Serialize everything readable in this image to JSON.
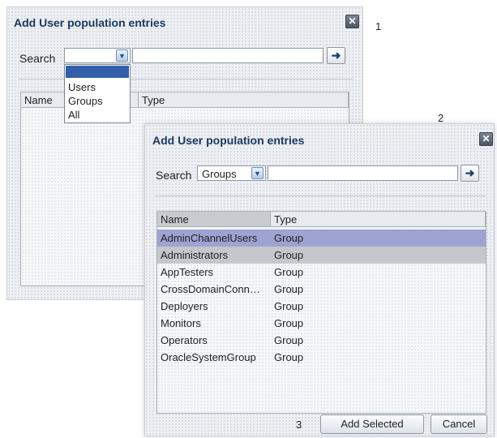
{
  "step_numbers": [
    "1",
    "2",
    "3"
  ],
  "dialog1": {
    "title": "Add User population entries",
    "close_icon": "close-icon",
    "search_label": "Search",
    "search_select_value": "",
    "search_input_value": "",
    "dropdown_options": [
      "",
      "Users",
      "Groups",
      "All"
    ],
    "columns": [
      "Name",
      "Type"
    ]
  },
  "dialog2": {
    "title": "Add User population entries",
    "close_icon": "close-icon",
    "search_label": "Search",
    "search_select_value": "Groups",
    "search_input_value": "",
    "columns": [
      "Name",
      "Type"
    ],
    "rows": [
      {
        "name": "AdminChannelUsers",
        "type": "Group"
      },
      {
        "name": "Administrators",
        "type": "Group"
      },
      {
        "name": "AppTesters",
        "type": "Group"
      },
      {
        "name": "CrossDomainConn…",
        "type": "Group"
      },
      {
        "name": "Deployers",
        "type": "Group"
      },
      {
        "name": "Monitors",
        "type": "Group"
      },
      {
        "name": "Operators",
        "type": "Group"
      },
      {
        "name": "OracleSystemGroup",
        "type": "Group"
      }
    ],
    "add_selected_label": "Add Selected",
    "cancel_label": "Cancel"
  },
  "colors": {
    "row_selected": "#9ea3d2",
    "row_hover": "#c4c7cc",
    "title_text": "#1a3a60"
  }
}
